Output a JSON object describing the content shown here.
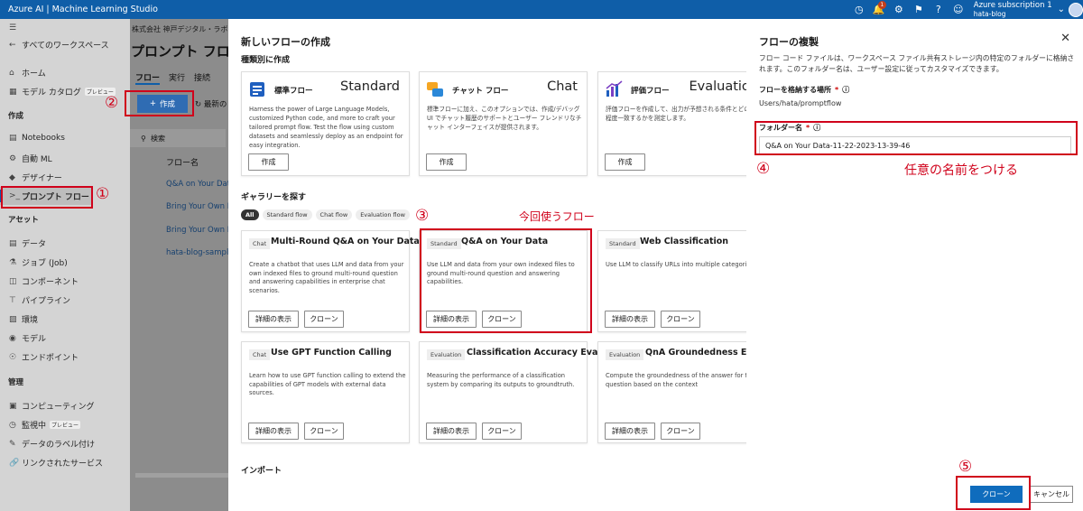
{
  "topbar": {
    "app_title": "Azure AI | Machine Learning Studio",
    "notification_count": "1",
    "subscription": "Azure subscription 1",
    "workspace": "hata-blog"
  },
  "sidebar": {
    "all_workspaces": "すべてのワークスペース",
    "home": "ホーム",
    "model_catalog": "モデル カタログ",
    "preview_badge": "プレビュー",
    "section_author": "作成",
    "notebooks": "Notebooks",
    "automl": "自動 ML",
    "designer": "デザイナー",
    "prompt_flow": "プロンプト フロー",
    "section_assets": "アセット",
    "data": "データ",
    "jobs": "ジョブ (Job)",
    "components": "コンポーネント",
    "pipelines": "パイプライン",
    "environments": "環境",
    "models": "モデル",
    "endpoints": "エンドポイント",
    "section_manage": "管理",
    "compute": "コンピューティング",
    "monitoring": "監視中",
    "data_labeling": "データのラベル付け",
    "linked_services": "リンクされたサービス"
  },
  "background_page": {
    "breadcrumb": "株式会社 神戸デジタル・ラボ",
    "title": "プロンプト フロー",
    "tabs": [
      "フロー",
      "実行",
      "接続"
    ],
    "create_label": "作成",
    "refresh_label": "最新の",
    "search_placeholder": "検索",
    "column_name": "フロー名",
    "rows": [
      "Q&A on Your Data",
      "Bring Your Own Da",
      "Bring Your Own Da",
      "hata-blog-sample-"
    ]
  },
  "create_panel": {
    "title": "新しいフローの作成",
    "by_type": "種類別に作成",
    "types": [
      {
        "name": "標準フロー",
        "big": "Standard",
        "desc": "Harness the power of Large Language Models, customized Python code, and more to craft your tailored prompt flow. Test the flow using custom datasets and seamlessly deploy as an endpoint for easy integration.",
        "button": "作成"
      },
      {
        "name": "チャット フロー",
        "big": "Chat",
        "desc": "標準フローに加え、このオプションでは、作成/デバッグ UI でチャット履歴のサポートとユーザー フレンドリなチャット インターフェイスが提供されます。",
        "button": "作成"
      },
      {
        "name": "評価フロー",
        "big": "Evaluation",
        "desc": "評価フローを作成して、出力が予想される条件とどの程度一致するかを測定します。",
        "button": "作成"
      }
    ],
    "gallery_title": "ギャラリーを探す",
    "filters": [
      "All",
      "Standard flow",
      "Chat flow",
      "Evaluation flow"
    ],
    "gallery": [
      {
        "tag": "Chat",
        "title": "Multi-Round Q&A on Your Data",
        "desc": "Create a chatbot that uses LLM and data from your own indexed files to ground multi-round question and answering capabilities in enterprise chat scenarios."
      },
      {
        "tag": "Standard",
        "title": "Q&A on Your Data",
        "desc": "Use LLM and data from your own indexed files to ground multi-round question and answering capabilities."
      },
      {
        "tag": "Standard",
        "title": "Web Classification",
        "desc": "Use LLM to classify URLs into multiple categories."
      },
      {
        "tag": "Chat",
        "title": "Use GPT Function Calling",
        "desc": "Learn how to use GPT function calling to extend the capabilities of GPT models with external data sources."
      },
      {
        "tag": "Evaluation",
        "title": "Classification Accuracy Evalu...",
        "desc": "Measuring the performance of a classification system by comparing its outputs to groundtruth."
      },
      {
        "tag": "Evaluation",
        "title": "QnA Groundedness Evalua",
        "desc": "Compute the groundedness of the answer for the question based on the context"
      }
    ],
    "details_button": "詳細の表示",
    "clone_button": "クローン",
    "import_title": "インポート"
  },
  "clone_panel": {
    "title": "フローの複製",
    "description": "フロー コード ファイルは、ワークスペース ファイル共有ストレージ内の特定のフォルダーに格納されます。このフォルダー名は、ユーザー設定に従ってカスタマイズできます。",
    "location_label": "フローを格納する場所",
    "location_value": "Users/hata/promptflow",
    "folder_label": "フォルダー名",
    "folder_value": "Q&A on Your Data-11-22-2023-13-39-46",
    "clone_button": "クローン",
    "cancel_button": "キャンセル"
  },
  "annotations": {
    "n1": "①",
    "n2": "②",
    "n3": "③",
    "n4": "④",
    "n5": "⑤",
    "flow_note": "今回使うフロー",
    "name_note": "任意の名前をつける"
  },
  "colors": {
    "topbar": "#0f5ea8",
    "primary": "#0f6cbd",
    "annotation_red": "#d0021b"
  }
}
